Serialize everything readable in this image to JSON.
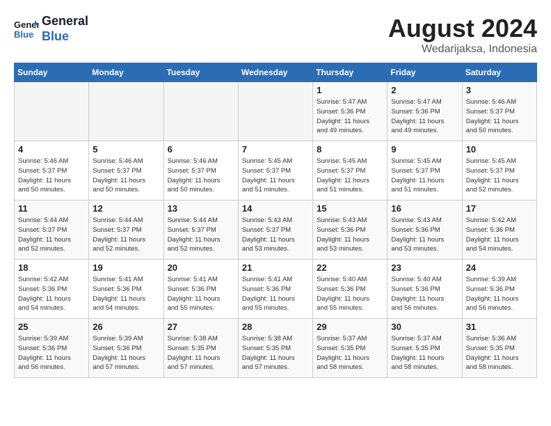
{
  "header": {
    "logo_line1": "General",
    "logo_line2": "Blue",
    "month_year": "August 2024",
    "location": "Wedarijaksa, Indonesia"
  },
  "days_of_week": [
    "Sunday",
    "Monday",
    "Tuesday",
    "Wednesday",
    "Thursday",
    "Friday",
    "Saturday"
  ],
  "weeks": [
    [
      {
        "day": "",
        "info": ""
      },
      {
        "day": "",
        "info": ""
      },
      {
        "day": "",
        "info": ""
      },
      {
        "day": "",
        "info": ""
      },
      {
        "day": "1",
        "info": "Sunrise: 5:47 AM\nSunset: 5:36 PM\nDaylight: 11 hours\nand 49 minutes."
      },
      {
        "day": "2",
        "info": "Sunrise: 5:47 AM\nSunset: 5:36 PM\nDaylight: 11 hours\nand 49 minutes."
      },
      {
        "day": "3",
        "info": "Sunrise: 5:46 AM\nSunset: 5:37 PM\nDaylight: 11 hours\nand 50 minutes."
      }
    ],
    [
      {
        "day": "4",
        "info": "Sunrise: 5:46 AM\nSunset: 5:37 PM\nDaylight: 11 hours\nand 50 minutes."
      },
      {
        "day": "5",
        "info": "Sunrise: 5:46 AM\nSunset: 5:37 PM\nDaylight: 11 hours\nand 50 minutes."
      },
      {
        "day": "6",
        "info": "Sunrise: 5:46 AM\nSunset: 5:37 PM\nDaylight: 11 hours\nand 50 minutes."
      },
      {
        "day": "7",
        "info": "Sunrise: 5:45 AM\nSunset: 5:37 PM\nDaylight: 11 hours\nand 51 minutes."
      },
      {
        "day": "8",
        "info": "Sunrise: 5:45 AM\nSunset: 5:37 PM\nDaylight: 11 hours\nand 51 minutes."
      },
      {
        "day": "9",
        "info": "Sunrise: 5:45 AM\nSunset: 5:37 PM\nDaylight: 11 hours\nand 51 minutes."
      },
      {
        "day": "10",
        "info": "Sunrise: 5:45 AM\nSunset: 5:37 PM\nDaylight: 11 hours\nand 52 minutes."
      }
    ],
    [
      {
        "day": "11",
        "info": "Sunrise: 5:44 AM\nSunset: 5:37 PM\nDaylight: 11 hours\nand 52 minutes."
      },
      {
        "day": "12",
        "info": "Sunrise: 5:44 AM\nSunset: 5:37 PM\nDaylight: 11 hours\nand 52 minutes."
      },
      {
        "day": "13",
        "info": "Sunrise: 5:44 AM\nSunset: 5:37 PM\nDaylight: 11 hours\nand 52 minutes."
      },
      {
        "day": "14",
        "info": "Sunrise: 5:43 AM\nSunset: 5:37 PM\nDaylight: 11 hours\nand 53 minutes."
      },
      {
        "day": "15",
        "info": "Sunrise: 5:43 AM\nSunset: 5:36 PM\nDaylight: 11 hours\nand 53 minutes."
      },
      {
        "day": "16",
        "info": "Sunrise: 5:43 AM\nSunset: 5:36 PM\nDaylight: 11 hours\nand 53 minutes."
      },
      {
        "day": "17",
        "info": "Sunrise: 5:42 AM\nSunset: 5:36 PM\nDaylight: 11 hours\nand 54 minutes."
      }
    ],
    [
      {
        "day": "18",
        "info": "Sunrise: 5:42 AM\nSunset: 5:36 PM\nDaylight: 11 hours\nand 54 minutes."
      },
      {
        "day": "19",
        "info": "Sunrise: 5:41 AM\nSunset: 5:36 PM\nDaylight: 11 hours\nand 54 minutes."
      },
      {
        "day": "20",
        "info": "Sunrise: 5:41 AM\nSunset: 5:36 PM\nDaylight: 11 hours\nand 55 minutes."
      },
      {
        "day": "21",
        "info": "Sunrise: 5:41 AM\nSunset: 5:36 PM\nDaylight: 11 hours\nand 55 minutes."
      },
      {
        "day": "22",
        "info": "Sunrise: 5:40 AM\nSunset: 5:36 PM\nDaylight: 11 hours\nand 55 minutes."
      },
      {
        "day": "23",
        "info": "Sunrise: 5:40 AM\nSunset: 5:36 PM\nDaylight: 11 hours\nand 56 minutes."
      },
      {
        "day": "24",
        "info": "Sunrise: 5:39 AM\nSunset: 5:36 PM\nDaylight: 11 hours\nand 56 minutes."
      }
    ],
    [
      {
        "day": "25",
        "info": "Sunrise: 5:39 AM\nSunset: 5:36 PM\nDaylight: 11 hours\nand 56 minutes."
      },
      {
        "day": "26",
        "info": "Sunrise: 5:39 AM\nSunset: 5:36 PM\nDaylight: 11 hours\nand 57 minutes."
      },
      {
        "day": "27",
        "info": "Sunrise: 5:38 AM\nSunset: 5:35 PM\nDaylight: 11 hours\nand 57 minutes."
      },
      {
        "day": "28",
        "info": "Sunrise: 5:38 AM\nSunset: 5:35 PM\nDaylight: 11 hours\nand 57 minutes."
      },
      {
        "day": "29",
        "info": "Sunrise: 5:37 AM\nSunset: 5:35 PM\nDaylight: 11 hours\nand 58 minutes."
      },
      {
        "day": "30",
        "info": "Sunrise: 5:37 AM\nSunset: 5:35 PM\nDaylight: 11 hours\nand 58 minutes."
      },
      {
        "day": "31",
        "info": "Sunrise: 5:36 AM\nSunset: 5:35 PM\nDaylight: 11 hours\nand 58 minutes."
      }
    ]
  ]
}
